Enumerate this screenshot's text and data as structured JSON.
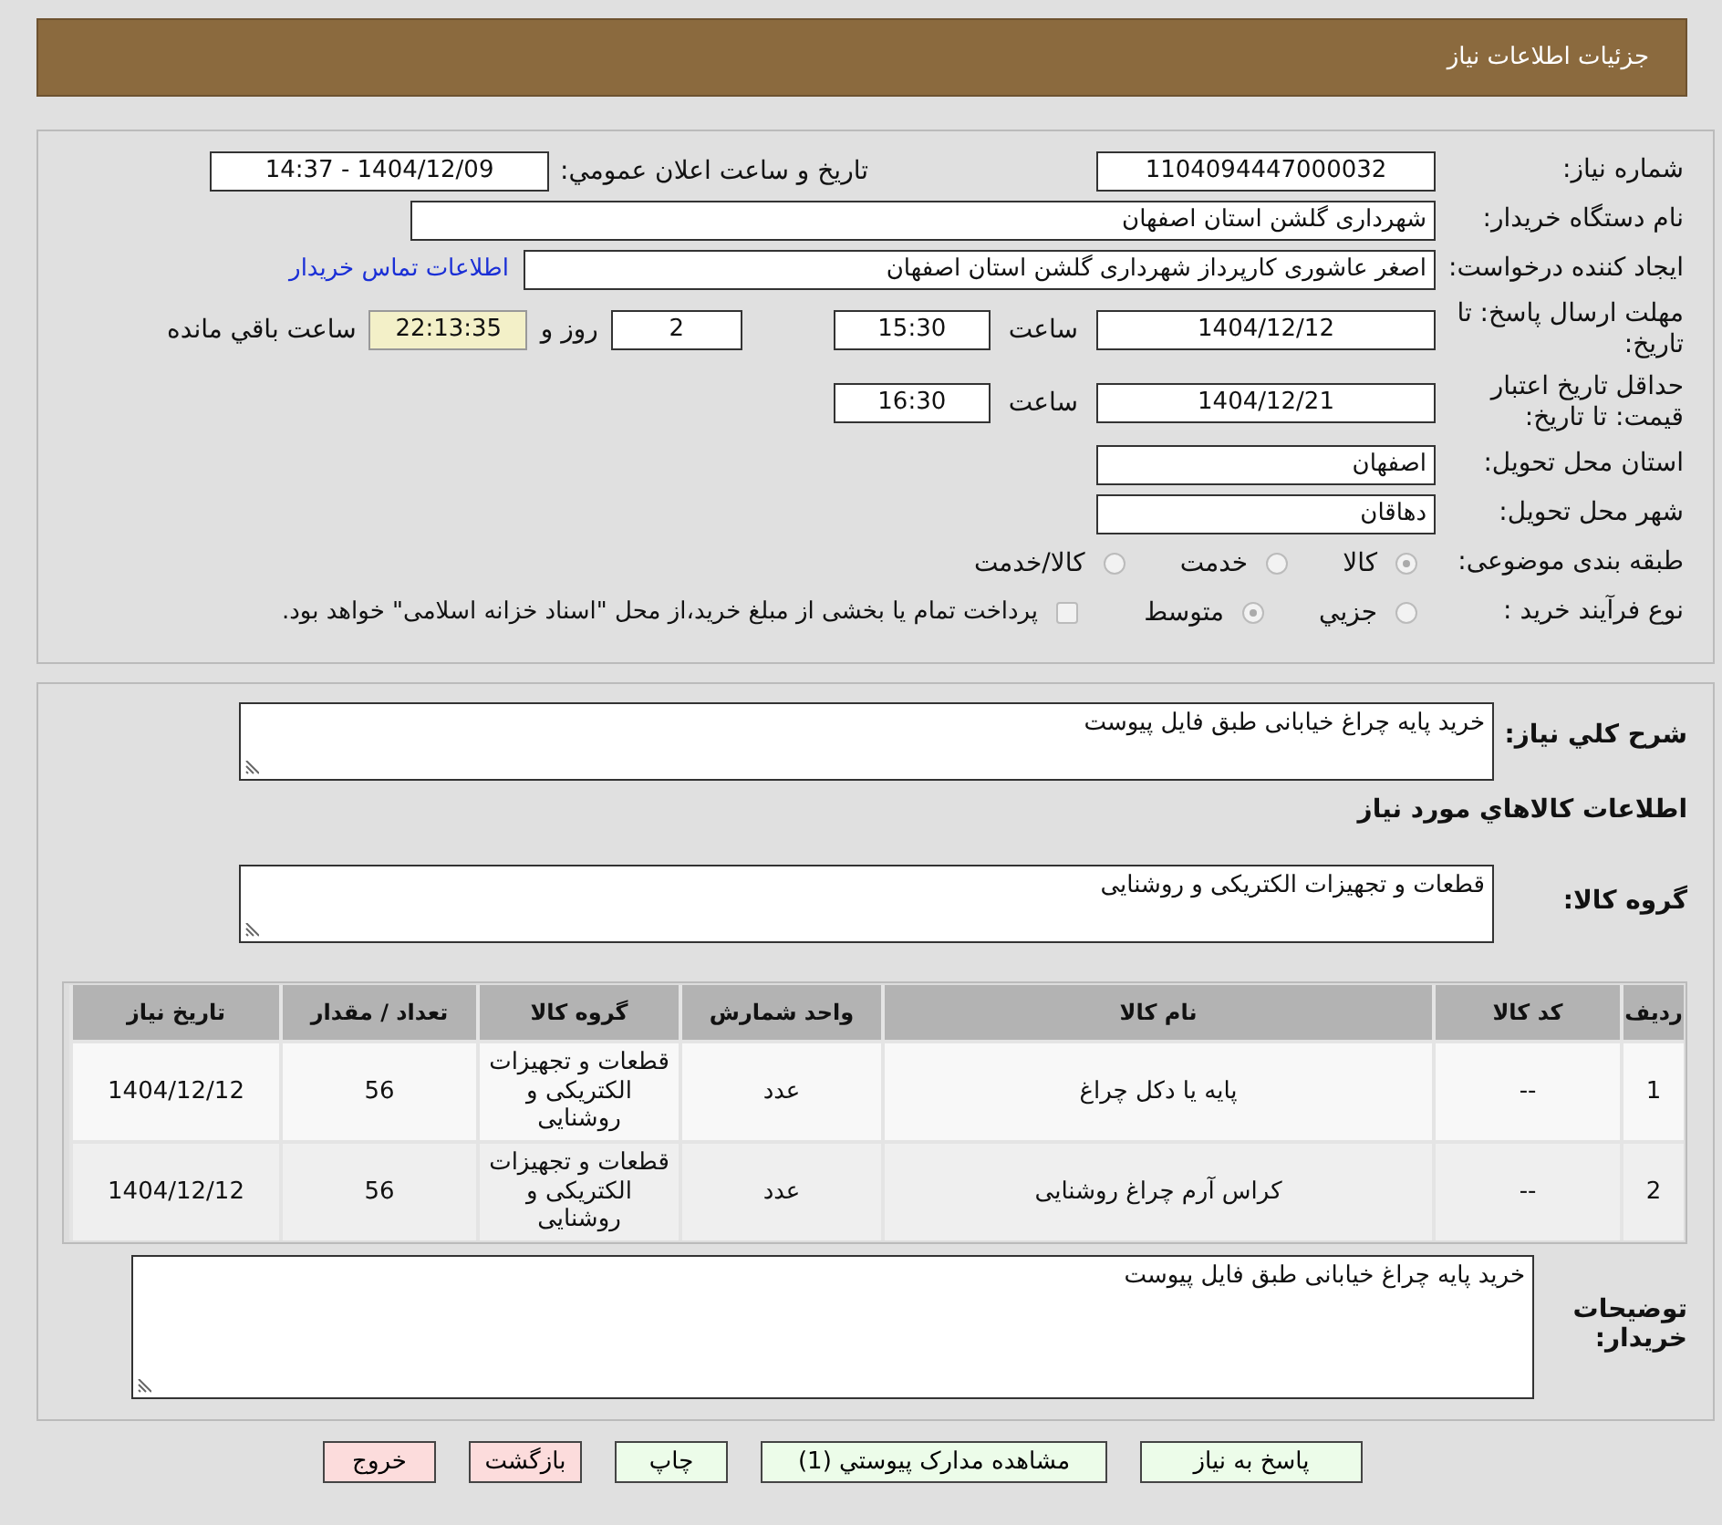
{
  "header": {
    "title": "جزئیات اطلاعات نیاز"
  },
  "need_number": {
    "label": "شماره نیاز:",
    "value": "1104094447000032"
  },
  "announce": {
    "label": "تاریخ و ساعت اعلان عمومي:",
    "value": "1404/12/09 - 14:37"
  },
  "buyer": {
    "label": "نام دستگاه خریدار:",
    "value": "شهرداری گلشن استان اصفهان"
  },
  "creator": {
    "label": "ایجاد کننده درخواست:",
    "value": "اصغر  عاشوری کارپرداز شهرداری گلشن استان اصفهان",
    "link": "اطلاعات تماس خریدار"
  },
  "deadline": {
    "label": "مهلت ارسال پاسخ: تا تاریخ:",
    "date": "1404/12/12",
    "time_label": "ساعت",
    "time": "15:30",
    "days": "2",
    "days_label": "روز و",
    "remaining": "22:13:35",
    "remaining_label": "ساعت باقي مانده"
  },
  "validity": {
    "label": "حداقل تاریخ اعتبار قیمت: تا تاریخ:",
    "date": "1404/12/21",
    "time_label": "ساعت",
    "time": "16:30"
  },
  "province": {
    "label": "استان محل تحویل:",
    "value": "اصفهان"
  },
  "city": {
    "label": "شهر محل تحویل:",
    "value": "دهاقان"
  },
  "category": {
    "label": "طبقه بندی موضوعی:",
    "options": [
      {
        "label": "کالا",
        "selected": true
      },
      {
        "label": "خدمت",
        "selected": false
      },
      {
        "label": "کالا/خدمت",
        "selected": false
      }
    ]
  },
  "process": {
    "label": "نوع فرآیند خرید :",
    "options": [
      {
        "label": "جزيي",
        "selected": false
      },
      {
        "label": "متوسط",
        "selected": true
      }
    ],
    "treasury": {
      "checked": false,
      "label": "پرداخت تمام یا بخشی از مبلغ خرید،از محل \"اسناد خزانه اسلامی\" خواهد بود."
    }
  },
  "summary": {
    "label": "شرح کلي نیاز:",
    "value": "خرید پایه چراغ خیابانی طبق فایل پیوست"
  },
  "goods_title": "اطلاعات کالاهاي مورد نیاز",
  "goods_group": {
    "label": "گروه کالا:",
    "value": "قطعات و تجهیزات الکتریکی و روشنایی"
  },
  "table": {
    "columns": [
      "ردیف",
      "کد کالا",
      "نام کالا",
      "واحد شمارش",
      "گروه کالا",
      "تعداد / مقدار",
      "تاریخ نیاز"
    ],
    "rows": [
      [
        "1",
        "--",
        "پایه یا دکل چراغ",
        "عدد",
        "قطعات و تجهیزات الکتریکی و روشنایی",
        "56",
        "1404/12/12"
      ],
      [
        "2",
        "--",
        "کراس آرم چراغ روشنایی",
        "عدد",
        "قطعات و تجهیزات الکتریکی و روشنایی",
        "56",
        "1404/12/12"
      ]
    ]
  },
  "notes": {
    "label": "توضیحات خریدار:",
    "value": "خرید پایه چراغ خیابانی طبق فایل پیوست"
  },
  "buttons": [
    {
      "label": "پاسخ به نیاز",
      "kind": "normal"
    },
    {
      "label": "مشاهده مدارک پیوستي (1)",
      "kind": "normal"
    },
    {
      "label": "چاپ",
      "kind": "normal"
    },
    {
      "label": "بازگشت",
      "kind": "danger"
    },
    {
      "label": "خروج",
      "kind": "danger"
    }
  ]
}
